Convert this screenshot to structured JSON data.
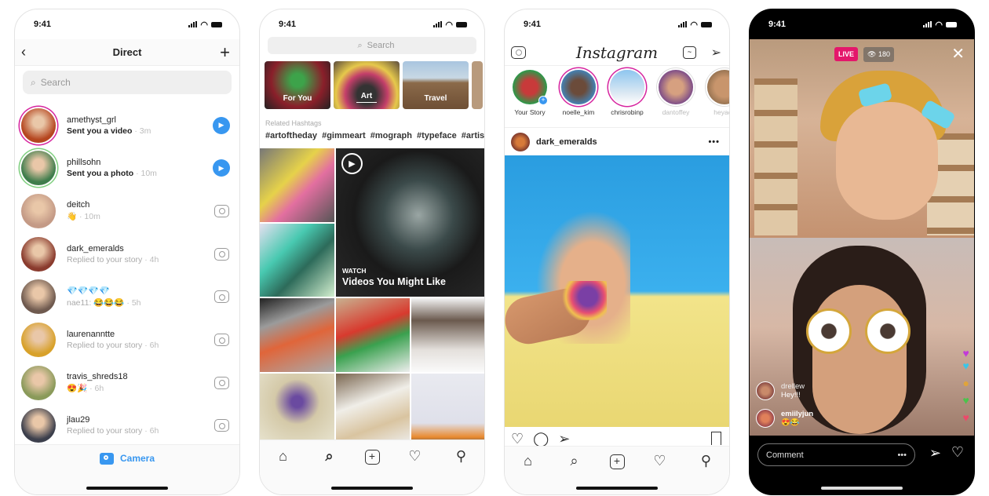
{
  "status_time": "9:41",
  "direct": {
    "title": "Direct",
    "back_icon": "‹",
    "new_icon": "+",
    "search_placeholder": "Search",
    "threads": [
      {
        "name": "amethyst_grl",
        "subtitle": "Sent you a video",
        "time": "· 3m",
        "unread": true,
        "action": "play",
        "avatar_color": "#b5461f"
      },
      {
        "name": "phillsohn",
        "subtitle": "Sent you a photo",
        "time": "· 10m",
        "unread": true,
        "action": "play",
        "avatar_color": "#3f7d4c"
      },
      {
        "name": "deitch",
        "subtitle": "👋",
        "time": "· 10m",
        "unread": false,
        "action": "camera",
        "avatar_color": "#c49a86"
      },
      {
        "name": "dark_emeralds",
        "subtitle": "Replied to your story",
        "time": "· 4h",
        "unread": false,
        "action": "camera",
        "avatar_color": "#8a3b2e"
      },
      {
        "name": "💎💎💎💎",
        "subtitle": "nae11: 😂😂😂",
        "time": "· 5h",
        "unread": false,
        "action": "camera",
        "avatar_color": "#6f5a4f"
      },
      {
        "name": "laurenanntte",
        "subtitle": "Replied to your story",
        "time": "· 6h",
        "unread": false,
        "action": "camera",
        "avatar_color": "#d8a12a"
      },
      {
        "name": "travis_shreds18",
        "subtitle": "😍🎉",
        "time": "· 6h",
        "unread": false,
        "action": "camera",
        "avatar_color": "#8a9a5a"
      },
      {
        "name": "jlau29",
        "subtitle": "Replied to your story",
        "time": "· 6h",
        "unread": false,
        "action": "camera",
        "avatar_color": "#3c3f4c"
      }
    ],
    "camera_label": "Camera"
  },
  "explore": {
    "search_placeholder": "Search",
    "topics": [
      {
        "label": "For You",
        "active": false
      },
      {
        "label": "Art",
        "active": true
      },
      {
        "label": "Travel",
        "active": false
      }
    ],
    "related_label": "Related Hashtags",
    "hashtags": "#artoftheday #gimmeart #mograph #typeface #artis",
    "watch_kicker": "WATCH",
    "watch_title": "Videos You Might Like"
  },
  "feed": {
    "logo": "Instagram",
    "stories": [
      {
        "name": "Your Story",
        "seen": false,
        "own": true
      },
      {
        "name": "noelle_kim",
        "seen": false,
        "own": false
      },
      {
        "name": "chrisrobinp",
        "seen": false,
        "own": false
      },
      {
        "name": "dantoffey",
        "seen": true,
        "own": false
      },
      {
        "name": "heyach",
        "seen": true,
        "own": false
      }
    ],
    "post_author": "dark_emeralds",
    "more_icon": "•••"
  },
  "live": {
    "badge": "LIVE",
    "viewers": "180",
    "comments": [
      {
        "user": "drellew",
        "text": "Hey!!!"
      },
      {
        "user": "emiilyjun",
        "text": "😍😂"
      }
    ],
    "comment_placeholder": "Comment",
    "more_icon": "•••"
  },
  "nav_icons": [
    "home",
    "search",
    "add",
    "activity",
    "profile"
  ]
}
